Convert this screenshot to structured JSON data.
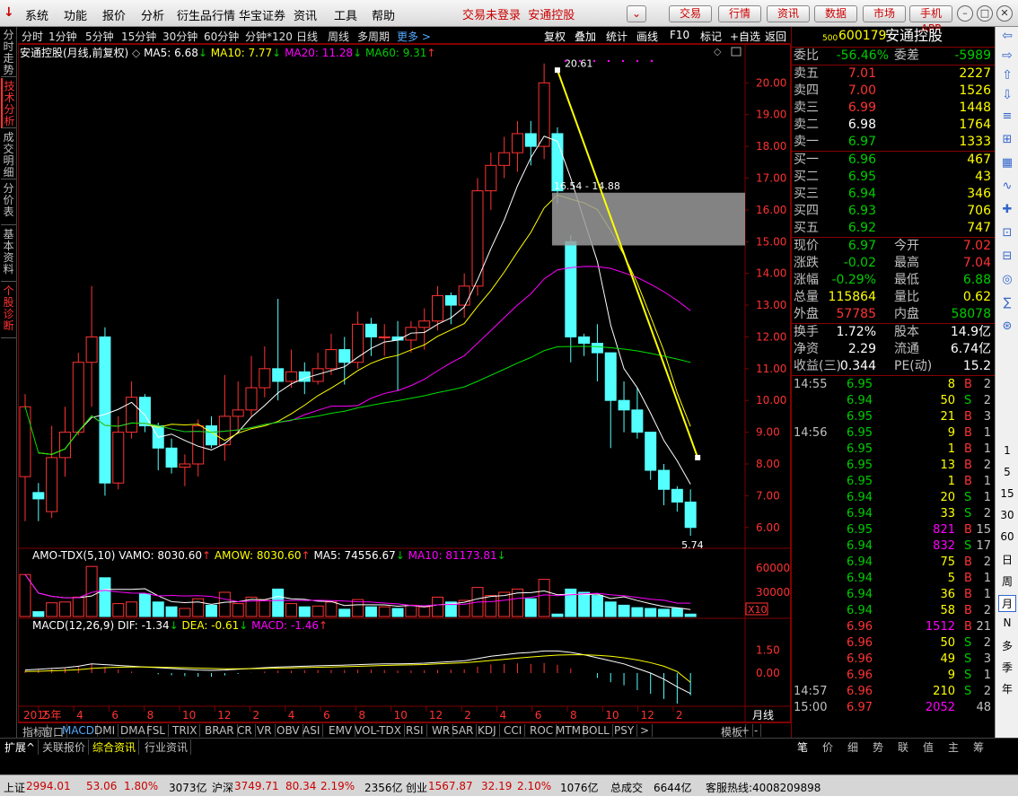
{
  "menubar": {
    "logo": "↓",
    "items": [
      "系统",
      "功能",
      "报价",
      "分析",
      "衍生品行情",
      "华宝证券",
      "资讯",
      "工具",
      "帮助"
    ],
    "trade_status": "交易未登录",
    "broker": "安通控股",
    "dropdown": "⌄",
    "buttons": [
      "交易",
      "行情",
      "资讯",
      "数据",
      "市场",
      "手机APP"
    ]
  },
  "left_tabs": [
    "分时走势",
    "技术分析",
    "成交明细",
    "分价表",
    "基本资料",
    "个股诊断"
  ],
  "period_bar": {
    "items": [
      "分时",
      "1分钟",
      "5分钟",
      "15分钟",
      "30分钟",
      "60分钟",
      "分钟*120",
      "日线",
      "周线",
      "多周期"
    ],
    "more": "更多 >",
    "right_items": [
      "复权",
      "叠加",
      "统计",
      "画线",
      "F10",
      "标记",
      "+自选",
      "返回"
    ]
  },
  "main_legend": {
    "title": "安通控股(月线,前复权)",
    "ma5": "MA5: 6.68",
    "ma10": "MA10: 7.77",
    "ma20": "MA20: 11.28",
    "ma60": "MA60: 9.31"
  },
  "price_axis": [
    "20.00",
    "19.00",
    "18.00",
    "17.00",
    "16.00",
    "15.00",
    "14.00",
    "13.00",
    "12.00",
    "11.00",
    "10.00",
    "9.00",
    "8.00",
    "7.00",
    "6.00"
  ],
  "annotations": {
    "high": "20.61",
    "low": "5.74",
    "zone": "16.54 - 14.88"
  },
  "vol_legend": {
    "name": "AMO-TDX(5,10)",
    "vamo": "VAMO: 8030.60",
    "amow": "AMOW: 8030.60",
    "ma5": "MA5: 74556.67",
    "ma10": "MA10: 81173.81"
  },
  "vol_axis": [
    "60000",
    "30000"
  ],
  "vol_unit": "X10",
  "macd_legend": {
    "name": "MACD(12,26,9)",
    "dif": "DIF: -1.34",
    "dea": "DEA: -0.61",
    "macd": "MACD: -1.46"
  },
  "macd_axis": [
    "1.50",
    "0.00"
  ],
  "time_axis": {
    "year": "2015年",
    "labels": [
      "2",
      "4",
      "6",
      "8",
      "10",
      "12",
      "2",
      "4",
      "6",
      "8",
      "10",
      "12",
      "2",
      "4",
      "6",
      "8",
      "10",
      "12",
      "2"
    ],
    "period": "月线"
  },
  "bottom_tabs": [
    "指标",
    "窗口",
    "MACD",
    "DMI",
    "DMA",
    "FSL",
    "TRIX",
    "BRAR",
    "CR",
    "VR",
    "OBV",
    "ASI",
    "EMV",
    "VOL-TDX",
    "RSI",
    "WR",
    "SAR",
    "KDJ",
    "CCI",
    "ROC",
    "MTM",
    "BOLL",
    "PSY",
    ">",
    "模板",
    "+",
    "-"
  ],
  "sub_tabs": [
    "扩展^",
    "关联报价",
    "综合资讯",
    "行业资讯"
  ],
  "right_bottom_tabs": [
    "笔",
    "价",
    "细",
    "势",
    "联",
    "值",
    "主",
    "筹"
  ],
  "quote": {
    "prefix": "500",
    "code": "600179",
    "name": "安通控股",
    "weibi_label": "委比",
    "weibi": "-56.46%",
    "weicha_label": "委差",
    "weicha": "-5989",
    "sells": [
      {
        "label": "卖五",
        "price": "7.01",
        "vol": "2227"
      },
      {
        "label": "卖四",
        "price": "7.00",
        "vol": "1526"
      },
      {
        "label": "卖三",
        "price": "6.99",
        "vol": "1448"
      },
      {
        "label": "卖二",
        "price": "6.98",
        "vol": "1764"
      },
      {
        "label": "卖一",
        "price": "6.97",
        "vol": "1333"
      }
    ],
    "buys": [
      {
        "label": "买一",
        "price": "6.96",
        "vol": "467"
      },
      {
        "label": "买二",
        "price": "6.95",
        "vol": "43"
      },
      {
        "label": "买三",
        "price": "6.94",
        "vol": "346"
      },
      {
        "label": "买四",
        "price": "6.93",
        "vol": "706"
      },
      {
        "label": "买五",
        "price": "6.92",
        "vol": "747"
      }
    ],
    "stats": [
      {
        "l1": "现价",
        "v1": "6.97",
        "l2": "今开",
        "v2": "7.02",
        "c1": "grn",
        "c2": "red"
      },
      {
        "l1": "涨跌",
        "v1": "-0.02",
        "l2": "最高",
        "v2": "7.04",
        "c1": "grn",
        "c2": "red"
      },
      {
        "l1": "涨幅",
        "v1": "-0.29%",
        "l2": "最低",
        "v2": "6.88",
        "c1": "grn",
        "c2": "grn"
      },
      {
        "l1": "总量",
        "v1": "115864",
        "l2": "量比",
        "v2": "0.62",
        "c1": "yel",
        "c2": "yel"
      },
      {
        "l1": "外盘",
        "v1": "57785",
        "l2": "内盘",
        "v2": "58078",
        "c1": "red",
        "c2": "grn"
      }
    ],
    "stats2": [
      {
        "l1": "换手",
        "v1": "1.72%",
        "l2": "股本",
        "v2": "14.9亿"
      },
      {
        "l1": "净资",
        "v1": "2.29",
        "l2": "流通",
        "v2": "6.74亿"
      },
      {
        "l1": "收益(三)",
        "v1": "0.344",
        "l2": "PE(动)",
        "v2": "15.2"
      }
    ],
    "ticks": [
      {
        "t": "14:55",
        "p": "6.95",
        "v": "8",
        "bs": "B",
        "n": "2"
      },
      {
        "t": "",
        "p": "6.94",
        "v": "50",
        "bs": "S",
        "n": "2"
      },
      {
        "t": "",
        "p": "6.95",
        "v": "21",
        "bs": "B",
        "n": "3"
      },
      {
        "t": "14:56",
        "p": "6.95",
        "v": "9",
        "bs": "B",
        "n": "1"
      },
      {
        "t": "",
        "p": "6.95",
        "v": "1",
        "bs": "B",
        "n": "1"
      },
      {
        "t": "",
        "p": "6.95",
        "v": "13",
        "bs": "B",
        "n": "2"
      },
      {
        "t": "",
        "p": "6.95",
        "v": "1",
        "bs": "B",
        "n": "1"
      },
      {
        "t": "",
        "p": "6.94",
        "v": "20",
        "bs": "S",
        "n": "1"
      },
      {
        "t": "",
        "p": "6.94",
        "v": "33",
        "bs": "S",
        "n": "2"
      },
      {
        "t": "",
        "p": "6.95",
        "v": "821",
        "bs": "B",
        "n": "15"
      },
      {
        "t": "",
        "p": "6.94",
        "v": "832",
        "bs": "S",
        "n": "17"
      },
      {
        "t": "",
        "p": "6.94",
        "v": "75",
        "bs": "B",
        "n": "2"
      },
      {
        "t": "",
        "p": "6.94",
        "v": "5",
        "bs": "B",
        "n": "1"
      },
      {
        "t": "",
        "p": "6.94",
        "v": "36",
        "bs": "B",
        "n": "1"
      },
      {
        "t": "",
        "p": "6.94",
        "v": "58",
        "bs": "B",
        "n": "2"
      },
      {
        "t": "",
        "p": "6.96",
        "v": "1512",
        "bs": "B",
        "n": "21"
      },
      {
        "t": "",
        "p": "6.96",
        "v": "50",
        "bs": "S",
        "n": "2"
      },
      {
        "t": "",
        "p": "6.96",
        "v": "49",
        "bs": "S",
        "n": "3"
      },
      {
        "t": "",
        "p": "6.96",
        "v": "9",
        "bs": "S",
        "n": "1"
      },
      {
        "t": "14:57",
        "p": "6.96",
        "v": "210",
        "bs": "S",
        "n": "2"
      },
      {
        "t": "15:00",
        "p": "6.97",
        "v": "2052",
        "bs": "",
        "n": "48"
      }
    ]
  },
  "right_tools": [
    "⇧",
    "⇩",
    "1",
    "5",
    "15",
    "30",
    "60",
    "日",
    "周",
    "月",
    "N",
    "多",
    "季",
    "年"
  ],
  "status": {
    "sh_label": "上证",
    "sh": "2994.01",
    "sh_chg": "53.06",
    "sh_pct": "1.80%",
    "sh_amt": "3073亿",
    "sz_label": "沪深",
    "sz": "3749.71",
    "sz_chg": "80.34",
    "sz_pct": "2.19%",
    "sz_amt": "2356亿",
    "cy_label": "创业",
    "cy": "1567.87",
    "cy_chg": "32.19",
    "cy_pct": "2.10%",
    "cy_amt": "1076亿",
    "total_label": "总成交",
    "total": "6644亿",
    "hotline": "客服热线:4008209898"
  },
  "colors": {
    "up": "#ff3232",
    "down": "#54ffff",
    "ma5": "#ffffff",
    "ma10": "#ffff00",
    "ma20": "#ff00ff",
    "ma60": "#00e000",
    "grid": "#800000",
    "trend": "#ffff00"
  },
  "chart_data": {
    "type": "candlestick",
    "title": "安通控股(月线,前复权)",
    "ylim": [
      5.4,
      20.8
    ],
    "categories": [
      "2015-01",
      "2015-02",
      "2015-03",
      "2015-04",
      "2015-05",
      "2015-06",
      "2015-07",
      "2015-08",
      "2015-09",
      "2015-10",
      "2015-11",
      "2015-12",
      "2016-01",
      "2016-02",
      "2016-03",
      "2016-04",
      "2016-05",
      "2016-06",
      "2016-07",
      "2016-08",
      "2016-09",
      "2016-10",
      "2016-11",
      "2016-12",
      "2017-01",
      "2017-02",
      "2017-03",
      "2017-04",
      "2017-05",
      "2017-06",
      "2017-07",
      "2017-08",
      "2017-09",
      "2017-10",
      "2017-11",
      "2017-12",
      "2018-01",
      "2018-02",
      "2018-03",
      "2018-04",
      "2018-05",
      "2018-06",
      "2018-07",
      "2018-08",
      "2018-09",
      "2018-10",
      "2018-11",
      "2018-12",
      "2019-01",
      "2019-02",
      "2019-03"
    ],
    "ohlc": [
      [
        7.6,
        9.8,
        6.2,
        10.2
      ],
      [
        7.1,
        6.9,
        6.2,
        7.4
      ],
      [
        6.5,
        8.2,
        6.3,
        9.2
      ],
      [
        8.2,
        9.0,
        7.6,
        9.8
      ],
      [
        9.0,
        11.2,
        8.9,
        11.5
      ],
      [
        11.2,
        12.0,
        9.8,
        13.6
      ],
      [
        12.0,
        7.4,
        7.0,
        12.3
      ],
      [
        7.4,
        9.0,
        7.2,
        9.5
      ],
      [
        9.0,
        10.1,
        8.8,
        10.6
      ],
      [
        10.1,
        9.2,
        9.0,
        10.2
      ],
      [
        9.2,
        8.5,
        7.8,
        9.3
      ],
      [
        8.5,
        7.9,
        7.7,
        8.8
      ],
      [
        7.9,
        8.0,
        7.3,
        8.3
      ],
      [
        8.0,
        9.2,
        7.6,
        9.4
      ],
      [
        9.2,
        8.6,
        8.5,
        9.5
      ],
      [
        8.6,
        9.5,
        8.1,
        10.8
      ],
      [
        9.5,
        9.7,
        9.0,
        10.6
      ],
      [
        9.7,
        10.4,
        9.5,
        11.4
      ],
      [
        10.4,
        11.0,
        10.1,
        11.7
      ],
      [
        11.0,
        10.6,
        10.0,
        13.2
      ],
      [
        10.6,
        10.9,
        10.4,
        11.6
      ],
      [
        10.9,
        10.6,
        10.2,
        11.2
      ],
      [
        10.6,
        11.0,
        10.5,
        11.5
      ],
      [
        11.0,
        11.6,
        10.8,
        12.1
      ],
      [
        11.6,
        11.2,
        10.5,
        12.0
      ],
      [
        11.2,
        12.4,
        11.0,
        12.8
      ],
      [
        12.4,
        12.0,
        11.4,
        12.6
      ],
      [
        12.0,
        12.0,
        11.4,
        12.4
      ],
      [
        12.0,
        11.9,
        10.3,
        12.5
      ],
      [
        11.9,
        12.3,
        11.5,
        12.5
      ],
      [
        12.3,
        12.5,
        11.6,
        12.9
      ],
      [
        12.5,
        13.3,
        12.2,
        13.6
      ],
      [
        13.3,
        13.0,
        12.4,
        13.4
      ],
      [
        13.0,
        13.6,
        12.6,
        14.0
      ],
      [
        13.6,
        16.6,
        13.3,
        17.0
      ],
      [
        16.6,
        17.4,
        16.0,
        17.8
      ],
      [
        17.4,
        17.8,
        17.0,
        18.3
      ],
      [
        17.8,
        18.4,
        17.2,
        18.8
      ],
      [
        18.4,
        18.0,
        17.4,
        18.8
      ],
      [
        18.0,
        20.0,
        17.6,
        20.61
      ],
      [
        18.4,
        16.6,
        16.2,
        18.6
      ],
      [
        15.0,
        12.0,
        11.2,
        15.2
      ],
      [
        12.0,
        11.8,
        11.4,
        12.1
      ],
      [
        11.8,
        11.5,
        10.6,
        12.4
      ],
      [
        11.5,
        10.0,
        8.5,
        11.5
      ],
      [
        10.0,
        9.7,
        9.0,
        10.6
      ],
      [
        9.7,
        9.0,
        8.8,
        10.4
      ],
      [
        9.0,
        7.8,
        7.5,
        9.0
      ],
      [
        7.8,
        7.2,
        6.7,
        8.0
      ],
      [
        7.2,
        6.8,
        6.5,
        7.3
      ],
      [
        6.8,
        6.0,
        5.74,
        7.2
      ]
    ],
    "ma_labels": [
      "MA5",
      "MA10",
      "MA20",
      "MA60"
    ]
  }
}
